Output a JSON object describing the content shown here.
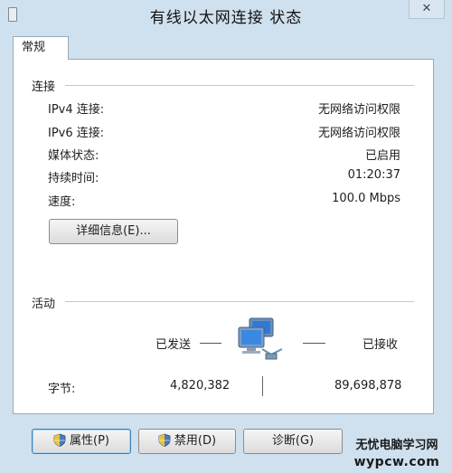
{
  "window": {
    "title": "有线以太网连接 状态",
    "close_label": "✕"
  },
  "tabs": [
    {
      "label": "常规"
    }
  ],
  "connection": {
    "title": "连接",
    "rows": [
      {
        "label": "IPv4 连接:",
        "value": "无网络访问权限"
      },
      {
        "label": "IPv6 连接:",
        "value": "无网络访问权限"
      },
      {
        "label": "媒体状态:",
        "value": "已启用"
      },
      {
        "label": "持续时间:",
        "value": "01:20:37"
      },
      {
        "label": "速度:",
        "value": "100.0 Mbps"
      }
    ],
    "details_button": "详细信息(E)..."
  },
  "activity": {
    "title": "活动",
    "sent_label": "已发送",
    "received_label": "已接收",
    "bytes_label": "字节:",
    "bytes_sent": "4,820,382",
    "bytes_received": "89,698,878"
  },
  "buttons": {
    "properties": "属性(P)",
    "disable": "禁用(D)",
    "diagnose": "诊断(G)"
  },
  "watermark": {
    "line1": "无忧电脑学习网",
    "line2": "wypcw.com"
  },
  "icons": {
    "network": "network-computers-icon",
    "shield": "uac-shield-icon"
  },
  "colors": {
    "window_frame": "#cfe0ee",
    "panel": "#ffffff",
    "focus_border": "#3c7fb1"
  }
}
